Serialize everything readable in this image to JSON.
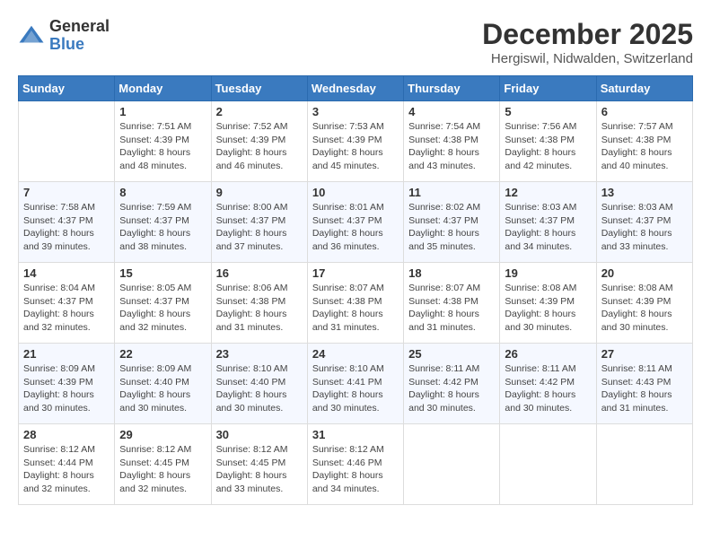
{
  "header": {
    "logo_general": "General",
    "logo_blue": "Blue",
    "month_title": "December 2025",
    "location": "Hergiswil, Nidwalden, Switzerland"
  },
  "weekdays": [
    "Sunday",
    "Monday",
    "Tuesday",
    "Wednesday",
    "Thursday",
    "Friday",
    "Saturday"
  ],
  "weeks": [
    [
      {
        "day": "",
        "info": ""
      },
      {
        "day": "1",
        "info": "Sunrise: 7:51 AM\nSunset: 4:39 PM\nDaylight: 8 hours\nand 48 minutes."
      },
      {
        "day": "2",
        "info": "Sunrise: 7:52 AM\nSunset: 4:39 PM\nDaylight: 8 hours\nand 46 minutes."
      },
      {
        "day": "3",
        "info": "Sunrise: 7:53 AM\nSunset: 4:39 PM\nDaylight: 8 hours\nand 45 minutes."
      },
      {
        "day": "4",
        "info": "Sunrise: 7:54 AM\nSunset: 4:38 PM\nDaylight: 8 hours\nand 43 minutes."
      },
      {
        "day": "5",
        "info": "Sunrise: 7:56 AM\nSunset: 4:38 PM\nDaylight: 8 hours\nand 42 minutes."
      },
      {
        "day": "6",
        "info": "Sunrise: 7:57 AM\nSunset: 4:38 PM\nDaylight: 8 hours\nand 40 minutes."
      }
    ],
    [
      {
        "day": "7",
        "info": "Sunrise: 7:58 AM\nSunset: 4:37 PM\nDaylight: 8 hours\nand 39 minutes."
      },
      {
        "day": "8",
        "info": "Sunrise: 7:59 AM\nSunset: 4:37 PM\nDaylight: 8 hours\nand 38 minutes."
      },
      {
        "day": "9",
        "info": "Sunrise: 8:00 AM\nSunset: 4:37 PM\nDaylight: 8 hours\nand 37 minutes."
      },
      {
        "day": "10",
        "info": "Sunrise: 8:01 AM\nSunset: 4:37 PM\nDaylight: 8 hours\nand 36 minutes."
      },
      {
        "day": "11",
        "info": "Sunrise: 8:02 AM\nSunset: 4:37 PM\nDaylight: 8 hours\nand 35 minutes."
      },
      {
        "day": "12",
        "info": "Sunrise: 8:03 AM\nSunset: 4:37 PM\nDaylight: 8 hours\nand 34 minutes."
      },
      {
        "day": "13",
        "info": "Sunrise: 8:03 AM\nSunset: 4:37 PM\nDaylight: 8 hours\nand 33 minutes."
      }
    ],
    [
      {
        "day": "14",
        "info": "Sunrise: 8:04 AM\nSunset: 4:37 PM\nDaylight: 8 hours\nand 32 minutes."
      },
      {
        "day": "15",
        "info": "Sunrise: 8:05 AM\nSunset: 4:37 PM\nDaylight: 8 hours\nand 32 minutes."
      },
      {
        "day": "16",
        "info": "Sunrise: 8:06 AM\nSunset: 4:38 PM\nDaylight: 8 hours\nand 31 minutes."
      },
      {
        "day": "17",
        "info": "Sunrise: 8:07 AM\nSunset: 4:38 PM\nDaylight: 8 hours\nand 31 minutes."
      },
      {
        "day": "18",
        "info": "Sunrise: 8:07 AM\nSunset: 4:38 PM\nDaylight: 8 hours\nand 31 minutes."
      },
      {
        "day": "19",
        "info": "Sunrise: 8:08 AM\nSunset: 4:39 PM\nDaylight: 8 hours\nand 30 minutes."
      },
      {
        "day": "20",
        "info": "Sunrise: 8:08 AM\nSunset: 4:39 PM\nDaylight: 8 hours\nand 30 minutes."
      }
    ],
    [
      {
        "day": "21",
        "info": "Sunrise: 8:09 AM\nSunset: 4:39 PM\nDaylight: 8 hours\nand 30 minutes."
      },
      {
        "day": "22",
        "info": "Sunrise: 8:09 AM\nSunset: 4:40 PM\nDaylight: 8 hours\nand 30 minutes."
      },
      {
        "day": "23",
        "info": "Sunrise: 8:10 AM\nSunset: 4:40 PM\nDaylight: 8 hours\nand 30 minutes."
      },
      {
        "day": "24",
        "info": "Sunrise: 8:10 AM\nSunset: 4:41 PM\nDaylight: 8 hours\nand 30 minutes."
      },
      {
        "day": "25",
        "info": "Sunrise: 8:11 AM\nSunset: 4:42 PM\nDaylight: 8 hours\nand 30 minutes."
      },
      {
        "day": "26",
        "info": "Sunrise: 8:11 AM\nSunset: 4:42 PM\nDaylight: 8 hours\nand 30 minutes."
      },
      {
        "day": "27",
        "info": "Sunrise: 8:11 AM\nSunset: 4:43 PM\nDaylight: 8 hours\nand 31 minutes."
      }
    ],
    [
      {
        "day": "28",
        "info": "Sunrise: 8:12 AM\nSunset: 4:44 PM\nDaylight: 8 hours\nand 32 minutes."
      },
      {
        "day": "29",
        "info": "Sunrise: 8:12 AM\nSunset: 4:45 PM\nDaylight: 8 hours\nand 32 minutes."
      },
      {
        "day": "30",
        "info": "Sunrise: 8:12 AM\nSunset: 4:45 PM\nDaylight: 8 hours\nand 33 minutes."
      },
      {
        "day": "31",
        "info": "Sunrise: 8:12 AM\nSunset: 4:46 PM\nDaylight: 8 hours\nand 34 minutes."
      },
      {
        "day": "",
        "info": ""
      },
      {
        "day": "",
        "info": ""
      },
      {
        "day": "",
        "info": ""
      }
    ]
  ]
}
